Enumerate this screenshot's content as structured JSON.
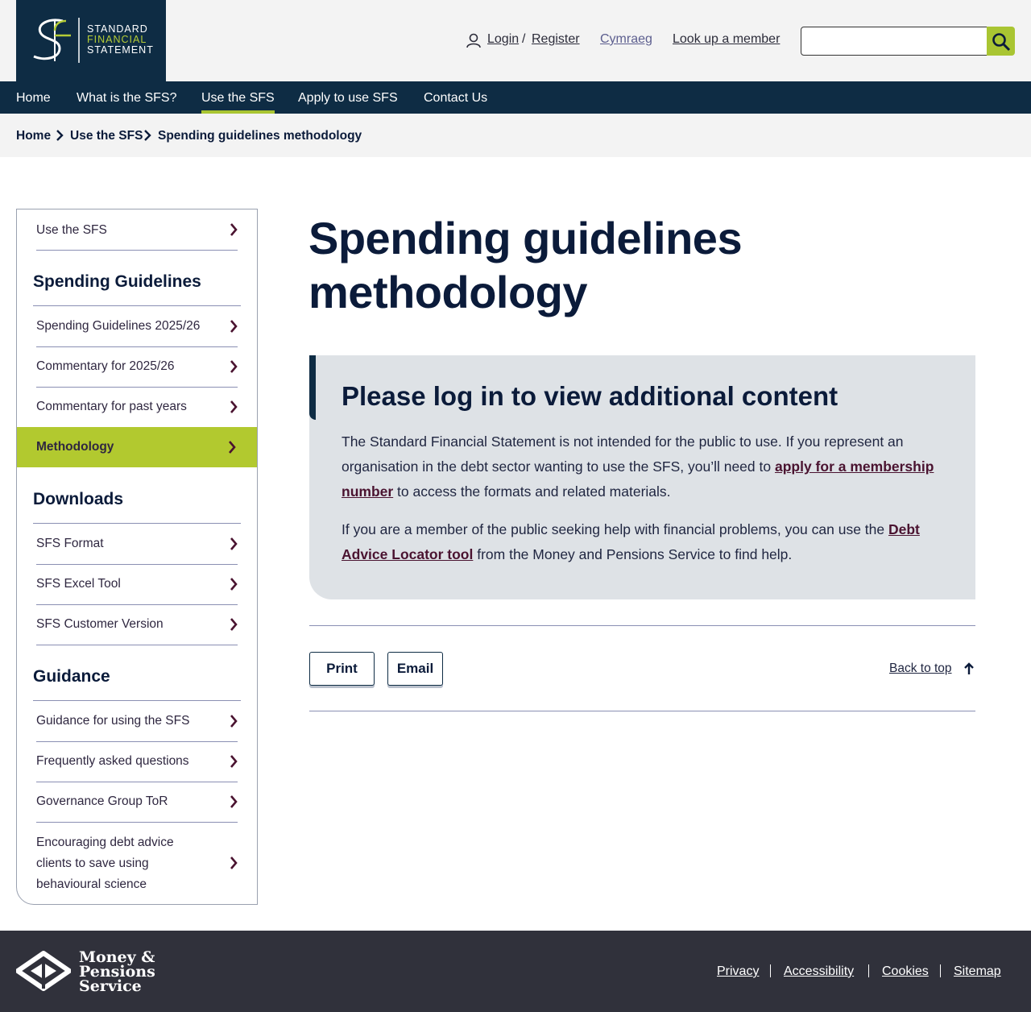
{
  "logo": {
    "line1": "STANDARD",
    "line2": "FINANCIAL",
    "line3": "STATEMENT"
  },
  "header": {
    "login": "Login",
    "separator": "/",
    "register": "Register",
    "language": "Cymraeg",
    "lookup": "Look up a member",
    "search_value": ""
  },
  "nav": {
    "items": [
      {
        "label": "Home",
        "active": false
      },
      {
        "label": "What is the SFS?",
        "active": false
      },
      {
        "label": "Use the SFS",
        "active": true
      },
      {
        "label": "Apply to use SFS",
        "active": false
      },
      {
        "label": "Contact Us",
        "active": false
      }
    ]
  },
  "breadcrumb": [
    "Home",
    "Use the SFS",
    "Spending guidelines methodology"
  ],
  "sidebar": {
    "top_item": "Use the SFS",
    "sections": [
      {
        "heading": "Spending Guidelines",
        "items": [
          "Spending Guidelines 2025/26",
          "Commentary for 2025/26",
          "Commentary for past years",
          "Methodology"
        ],
        "active_item": "Methodology"
      },
      {
        "heading": "Downloads",
        "items": [
          "SFS Format",
          "SFS Excel Tool",
          "SFS Customer Version"
        ]
      },
      {
        "heading": "Guidance",
        "items": [
          "Guidance for using the SFS",
          "Frequently asked questions",
          "Governance Group ToR",
          "Encouraging debt advice clients to save using behavioural science"
        ]
      }
    ]
  },
  "main": {
    "title": "Spending guidelines methodology",
    "notice": {
      "title": "Please log in to view additional content",
      "p1_before": "The Standard Financial Statement is not intended for the public to use. If you represent an organisation in the debt sector wanting to use the SFS, you’ll need to ",
      "p1_link": "apply for a membership number",
      "p1_after": " to access the formats and related materials.",
      "p2_before": "If you are a member of the public seeking help with financial problems, you can use the ",
      "p2_link": "Debt Advice Locator tool",
      "p2_after": " from the Money and Pensions Service to find help."
    },
    "print_label": "Print",
    "email_label": "Email",
    "back_to_top": "Back to top"
  },
  "footer": {
    "logo_line1": "Money &",
    "logo_line2": "Pensions",
    "logo_line3": "Service",
    "links": [
      "Privacy",
      "Accessibility",
      "Cookies",
      "Sitemap"
    ]
  },
  "colors": {
    "navy": "#0e2c44",
    "lime": "#b2c92f",
    "footer_bg": "#30313b",
    "notice_bg": "#dee2e6",
    "link_maroon": "#4a1330"
  }
}
